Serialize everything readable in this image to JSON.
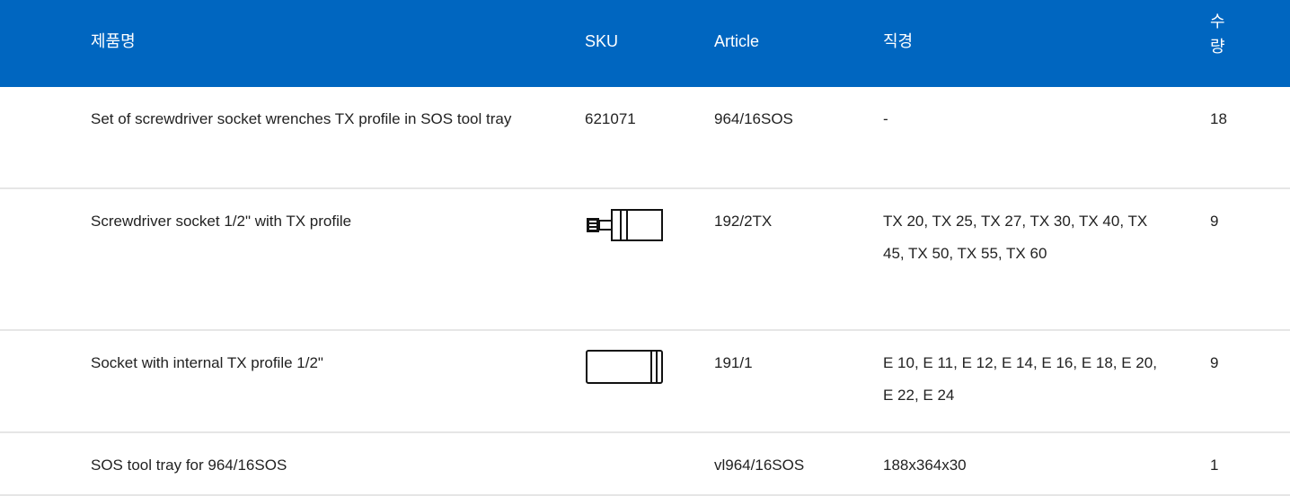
{
  "table": {
    "headers": {
      "name": "제품명",
      "sku": "SKU",
      "article": "Article",
      "diameter": "직경",
      "qty": "수량"
    },
    "rows": [
      {
        "name": "Set of screwdriver socket wrenches TX profile in SOS tool tray",
        "sku": "621071",
        "article": "964/16SOS",
        "diameter": "-",
        "qty": "18"
      },
      {
        "name": "Screwdriver socket 1/2\" with TX profile",
        "sku_icon": "screwdriver-socket-image",
        "article": "192/2TX",
        "diameter": "TX 20, TX 25, TX 27, TX 30, TX 40, TX 45, TX 50, TX 55, TX 60",
        "qty": "9"
      },
      {
        "name": "Socket with internal TX profile 1/2\"",
        "sku_icon": "socket-image",
        "article": "191/1",
        "diameter": "E 10, E 11, E 12, E 14, E 16, E 18, E 20, E 22, E 24",
        "qty": "9"
      },
      {
        "name": "SOS tool tray for 964/16SOS",
        "sku": "",
        "article": "vl964/16SOS",
        "diameter": "188x364x30",
        "qty": "1"
      }
    ]
  },
  "colors": {
    "header_bg": "#0066c0",
    "header_text": "#ffffff",
    "divider": "#e6e6e6"
  }
}
